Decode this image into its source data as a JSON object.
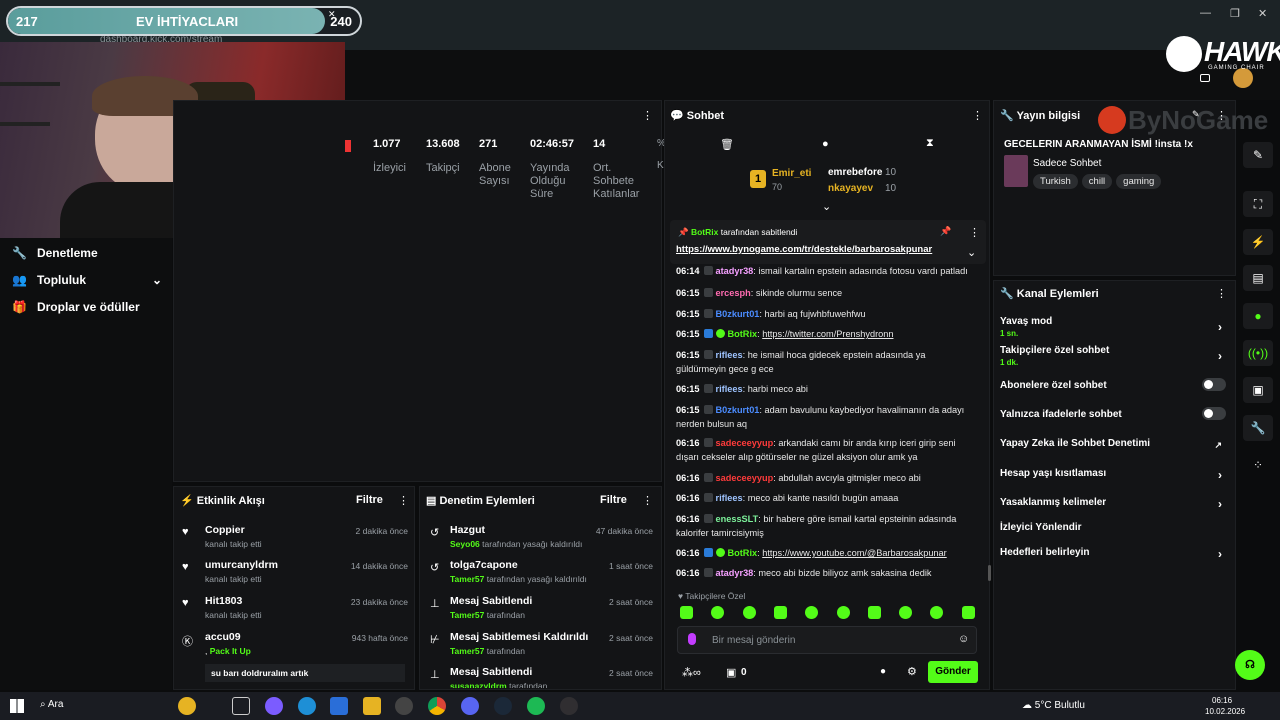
{
  "goal": {
    "current": "217",
    "title": "EV İHTİYACLARI",
    "target": "240",
    "progress_fraction": 0.9
  },
  "browser": {
    "url": "dashboard.kick.com/stream"
  },
  "sidebar": {
    "items": [
      {
        "label": "Denetleme"
      },
      {
        "label": "Topluluk"
      },
      {
        "label": "Droplar ve ödüller"
      }
    ]
  },
  "stats": [
    {
      "value": "1.077",
      "label": "İzleyici"
    },
    {
      "value": "13.608",
      "label": "Takipçi"
    },
    {
      "value": "271",
      "label": "Abone Sayısı"
    },
    {
      "value": "02:46:57",
      "label": "Yayında Olduğu Süre"
    },
    {
      "value": "14",
      "label": "Ort. Sohbete Katılanlar"
    }
  ],
  "activity": {
    "title": "Etkinlik Akışı",
    "filter": "Filtre",
    "items": [
      {
        "name": "Coppier",
        "sub": "kanalı takip etti",
        "time": "2 dakika önce"
      },
      {
        "name": "umurcanyldrm",
        "sub": "kanalı takip etti",
        "time": "14 dakika önce"
      },
      {
        "name": "Hit1803",
        "sub": "kanalı takip etti",
        "time": "23 dakika önce"
      },
      {
        "name": "accu09",
        "sub": "Pack It Up",
        "time": "943 hafta önce",
        "note": "su barı doldruralım artık"
      }
    ]
  },
  "moderation": {
    "title": "Denetim Eylemleri",
    "filter": "Filtre",
    "items": [
      {
        "name": "Hazgut",
        "by": "Seyo06",
        "rest": "tarafından yasağı kaldırıldı",
        "time": "47 dakika önce"
      },
      {
        "name": "tolga7capone",
        "by": "Tamer57",
        "rest": "tarafından yasağı kaldırıldı",
        "time": "1 saat önce"
      },
      {
        "name": "Mesaj Sabitlendi",
        "by": "Tamer57",
        "rest": "tarafından",
        "time": "2 saat önce"
      },
      {
        "name": "Mesaj Sabitlemesi Kaldırıldı",
        "by": "Tamer57",
        "rest": "tarafından",
        "time": "2 saat önce"
      },
      {
        "name": "Mesaj Sabitlendi",
        "by": "susanazyldrm",
        "rest": "tarafından",
        "time": "2 saat önce"
      }
    ]
  },
  "chat": {
    "title": "Sohbet",
    "leaderboard": {
      "top": {
        "name": "Emir_eti",
        "points": "70",
        "rank": "1"
      },
      "others": [
        {
          "name": "emrebefore",
          "points": "10"
        },
        {
          "name": "nkayayev",
          "points": "10"
        }
      ]
    },
    "pinned": {
      "by": "BotRix",
      "label": "tarafından sabitlendi",
      "link": "https://www.bynogame.com/tr/destekle/barbarosakpunar"
    },
    "messages": [
      {
        "time": "06:14",
        "user": "atadyr38",
        "color": "#f5a0ff",
        "text": "ismail kartalın epstein adasında fotosu vardı patladı"
      },
      {
        "time": "06:15",
        "user": "ercesph",
        "color": "#ff6bb0",
        "text": "sikinde olurmu sence"
      },
      {
        "time": "06:15",
        "user": "B0zkurt01",
        "color": "#4b8cff",
        "text": "harbi aq fujwhbfuwehfwu"
      },
      {
        "time": "06:15",
        "user": "BotRix",
        "color": "#53fc18",
        "link": "https://twitter.com/Prenshydronn"
      },
      {
        "time": "06:15",
        "user": "riflees",
        "color": "#9ec3ff",
        "text": "he ismail hoca gidecek epstein adasında ya güldürmeyin gece g ece"
      },
      {
        "time": "06:15",
        "user": "riflees",
        "color": "#9ec3ff",
        "text": "harbi meco abi"
      },
      {
        "time": "06:15",
        "user": "B0zkurt01",
        "color": "#4b8cff",
        "text": "adam bavulunu kaybediyor havalimanın da adayı nerden bulsun aq"
      },
      {
        "time": "06:16",
        "user": "sadeceeyyup",
        "color": "#ff3b3b",
        "text": "arkandaki camı bir anda kırıp iceri girip seni dışarı cekseler alıp götürseler ne güzel aksiyon olur amk ya"
      },
      {
        "time": "06:16",
        "user": "sadeceeyyup",
        "color": "#ff3b3b",
        "text": "abdullah avcıyla gitmişler meco abi"
      },
      {
        "time": "06:16",
        "user": "riflees",
        "color": "#9ec3ff",
        "text": "meco abi kante nasıldı bugün amaaa"
      },
      {
        "time": "06:16",
        "user": "enessSLT",
        "color": "#7cf09a",
        "text": "bir habere göre ismail kartal epsteinin adasında kalorifer tamircisiymiş"
      },
      {
        "time": "06:16",
        "user": "BotRix",
        "color": "#53fc18",
        "link": "https://www.youtube.com/@Barbarosakpunar"
      },
      {
        "time": "06:16",
        "user": "atadyr38",
        "color": "#f5a0ff",
        "text": "meco abi bizde biliyoz amk sakasina dedik"
      }
    ],
    "followers_only": "Takipçilere Özel",
    "input_placeholder": "Bir mesaj gönderin",
    "points": "0",
    "send_label": "Gönder"
  },
  "stream_info": {
    "title": "Yayın bilgisi",
    "stream_title": "GECELERIN ARANMAYAN İSMİ !insta !x",
    "category": "Sadece Sohbet",
    "tags": [
      "Turkish",
      "chill",
      "gaming"
    ]
  },
  "channel_actions": {
    "title": "Kanal Eylemleri",
    "items": [
      {
        "label": "Yavaş mod",
        "sub": "1 sn.",
        "control": "chevron"
      },
      {
        "label": "Takipçilere özel sohbet",
        "sub": "1 dk.",
        "control": "chevron"
      },
      {
        "label": "Abonelere özel sohbet",
        "control": "toggle"
      },
      {
        "label": "Yalnızca ifadelerle sohbet",
        "control": "toggle"
      },
      {
        "label": "Yapay Zeka ile Sohbet Denetimi",
        "control": "external"
      },
      {
        "label": "Hesap yaşı kısıtlaması",
        "control": "chevron"
      },
      {
        "label": "Yasaklanmış kelimeler",
        "control": "chevron"
      },
      {
        "label": "İzleyici Yönlendir",
        "control": "none"
      },
      {
        "label": "Hedefleri belirleyin",
        "control": "chevron"
      }
    ]
  },
  "overlay": {
    "hawk": "HAWK",
    "hawk_sub": "GAMING CHAIR",
    "bynogame": "ByNoGame"
  },
  "taskbar": {
    "search": "Ara",
    "weather": "5°C Bulutlu",
    "time": "06:16",
    "date": "10.02.2026"
  }
}
